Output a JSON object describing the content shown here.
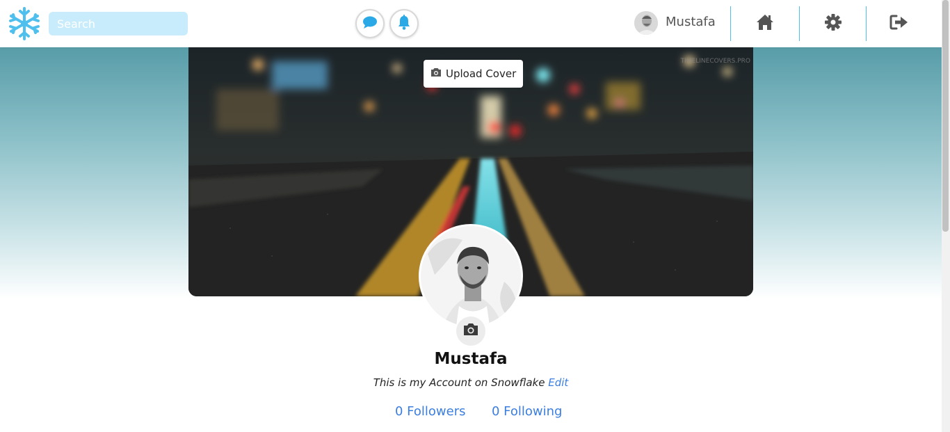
{
  "header": {
    "logo_icon": "snowflake-icon",
    "search_placeholder": "Search",
    "chat_icon": "chat-bubble-icon",
    "bell_icon": "bell-icon",
    "user_name": "Mustafa",
    "nav": [
      {
        "icon": "home-icon"
      },
      {
        "icon": "gear-icon"
      },
      {
        "icon": "logout-icon"
      }
    ]
  },
  "cover": {
    "upload_label": "Upload Cover",
    "watermark": "TIMELINECOVERS.PRO"
  },
  "profile": {
    "name": "Mustafa",
    "bio_text": "This is my Account on Snowflake",
    "edit_label": "Edit",
    "followers_label": "0 Followers",
    "following_label": "0 Following"
  },
  "colors": {
    "accent": "#4fc0ee",
    "link": "#3b7ee0",
    "search_bg": "#c8ecfb"
  }
}
